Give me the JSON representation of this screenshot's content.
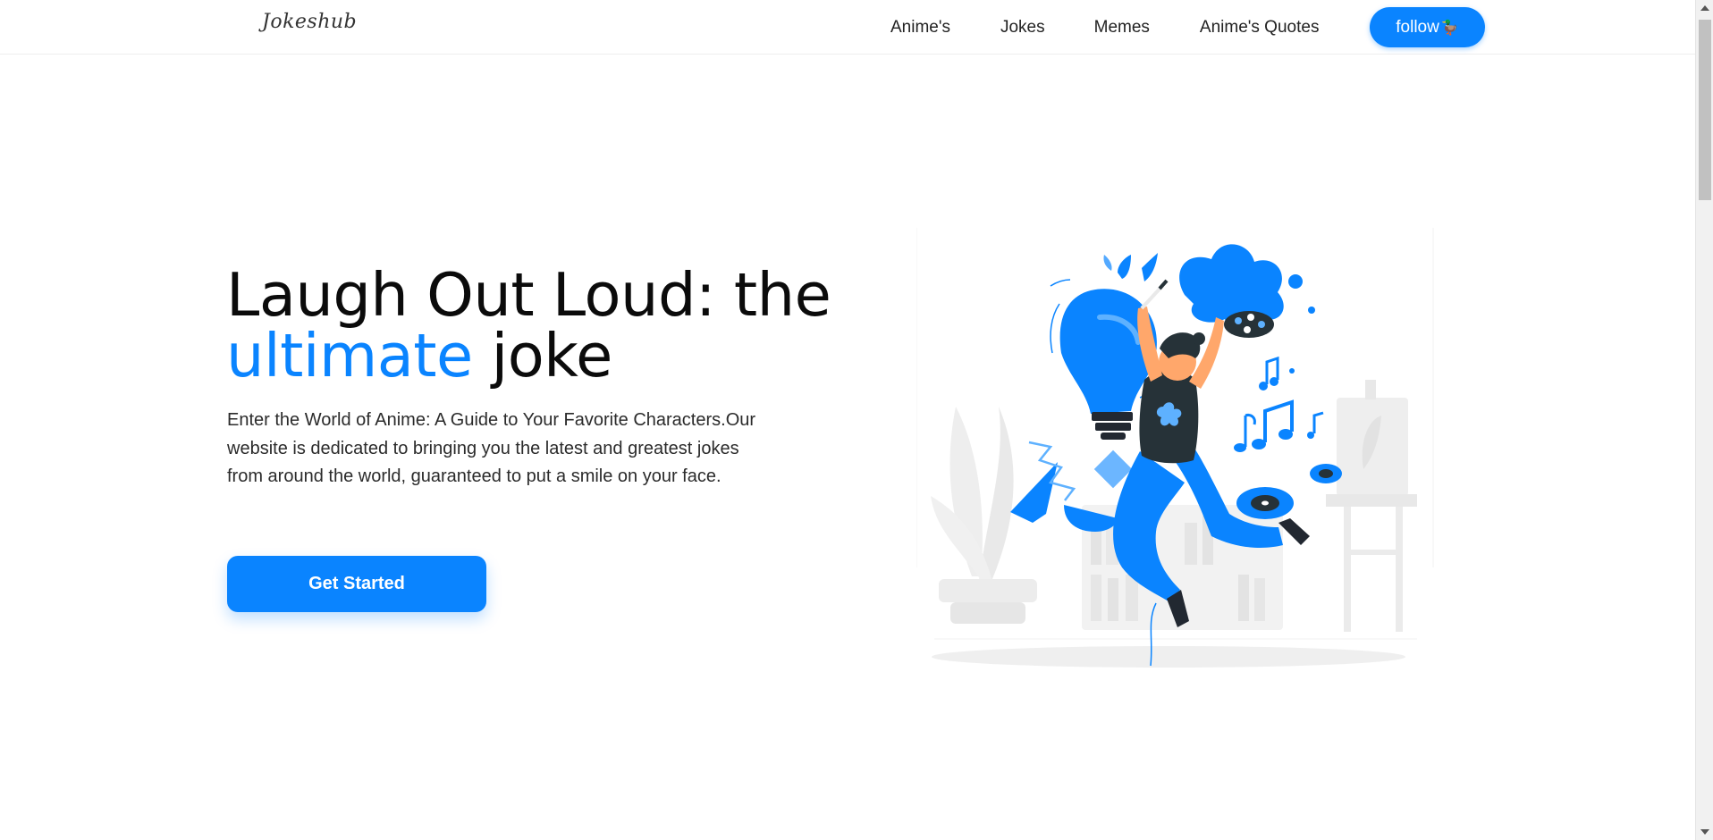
{
  "navbar": {
    "brand": "Jokeshub",
    "links": [
      "Anime's",
      "Jokes",
      "Memes",
      "Anime's Quotes"
    ],
    "follow_label": "follow",
    "follow_emoji": "🦆"
  },
  "hero": {
    "title_line1": "Laugh Out Loud: the",
    "title_accent": "ultimate",
    "title_rest": " joke",
    "description": "Enter the World of Anime: A Guide to Your Favorite Characters.Our website is dedicated to bringing you the latest and greatest jokes from around the world, guaranteed to put a smile on your face.",
    "cta_label": "Get Started"
  },
  "colors": {
    "accent": "#0a84ff",
    "text": "#0b0b0b",
    "muted_illustration": "#ececec"
  },
  "illustration": {
    "icon": "jumping-artist-illustration"
  }
}
